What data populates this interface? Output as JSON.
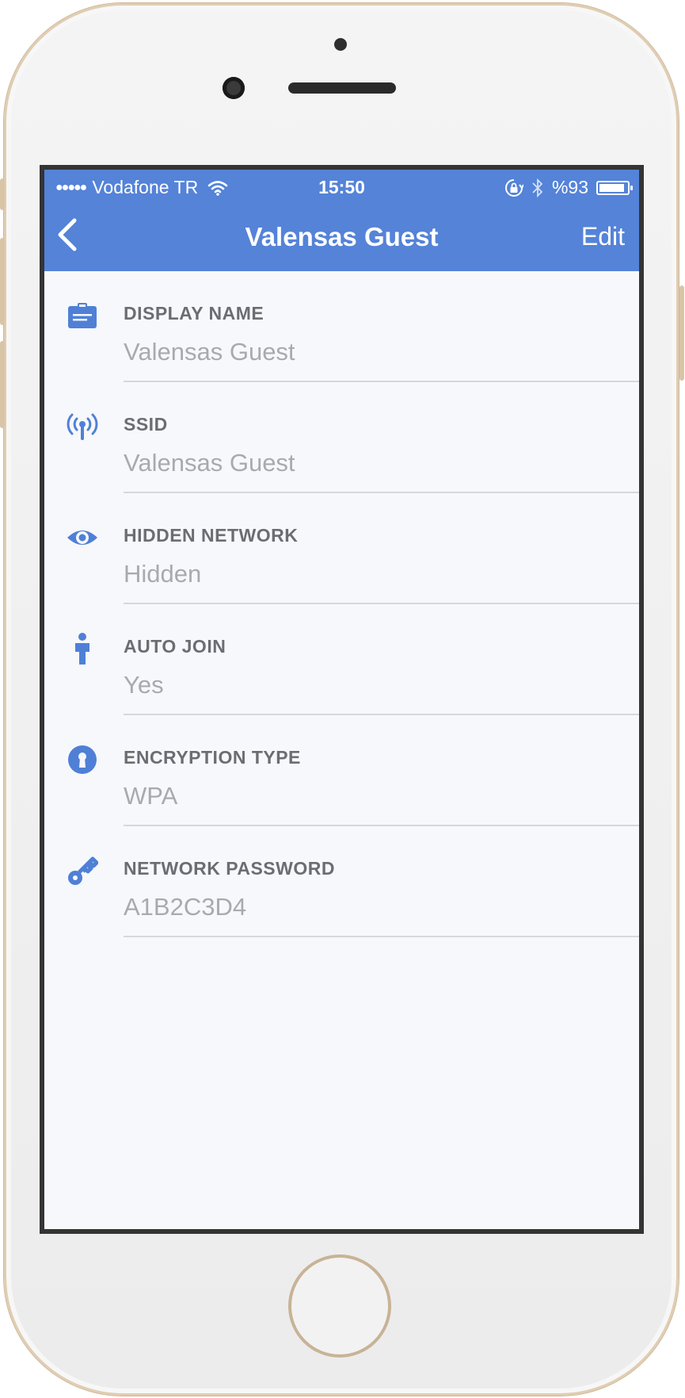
{
  "status_bar": {
    "carrier": "Vodafone TR",
    "time": "15:50",
    "battery": "%93",
    "battery_level": 0.93
  },
  "nav": {
    "title": "Valensas Guest",
    "edit_label": "Edit"
  },
  "fields": [
    {
      "icon": "id-card-icon",
      "label": "DISPLAY NAME",
      "value": "Valensas Guest"
    },
    {
      "icon": "broadcast-signal-icon",
      "label": "SSID",
      "value": "Valensas Guest"
    },
    {
      "icon": "eye-icon",
      "label": "HIDDEN NETWORK",
      "value": "Hidden"
    },
    {
      "icon": "person-icon",
      "label": "AUTO JOIN",
      "value": "Yes"
    },
    {
      "icon": "keyhole-icon",
      "label": "ENCRYPTION TYPE",
      "value": "WPA"
    },
    {
      "icon": "key-icon",
      "label": "NETWORK PASSWORD",
      "value": "A1B2C3D4"
    }
  ],
  "colors": {
    "accent": "#5483d8",
    "icon": "#4f80d6",
    "label": "#6c6c72",
    "value": "#a9a9ae",
    "background": "#f7f8fc"
  }
}
